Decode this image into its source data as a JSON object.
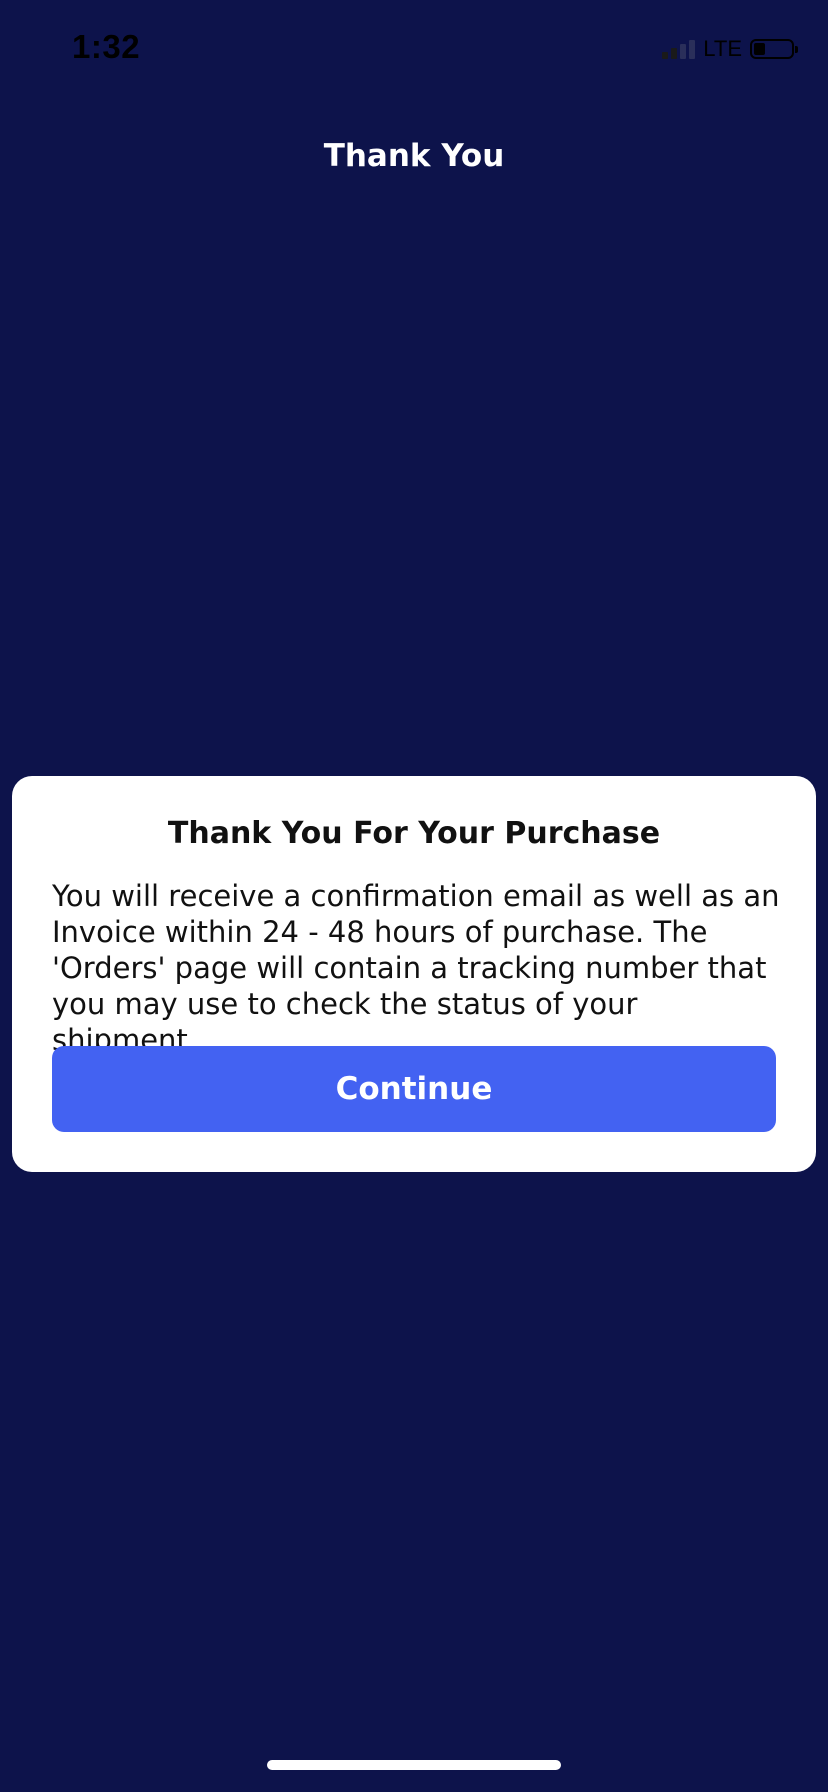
{
  "status_bar": {
    "time": "1:32",
    "network": "LTE",
    "signal_bars_active": 2,
    "signal_bars_total": 4,
    "battery_level": 0.3
  },
  "header": {
    "title": "Thank You"
  },
  "modal": {
    "title": "Thank You For Your Purchase",
    "body": "You will receive a confirmation email as well as an Invoice within 24 - 48 hours of purchase. The 'Orders' page will contain a tracking number that you may use to check the status of your shipment.",
    "button_label": "Continue"
  },
  "colors": {
    "background": "#0d134b",
    "card": "#ffffff",
    "button": "#4362f2",
    "button_text": "#ffffff"
  },
  "icons": {
    "signal": "signal-icon",
    "battery": "battery-icon"
  }
}
